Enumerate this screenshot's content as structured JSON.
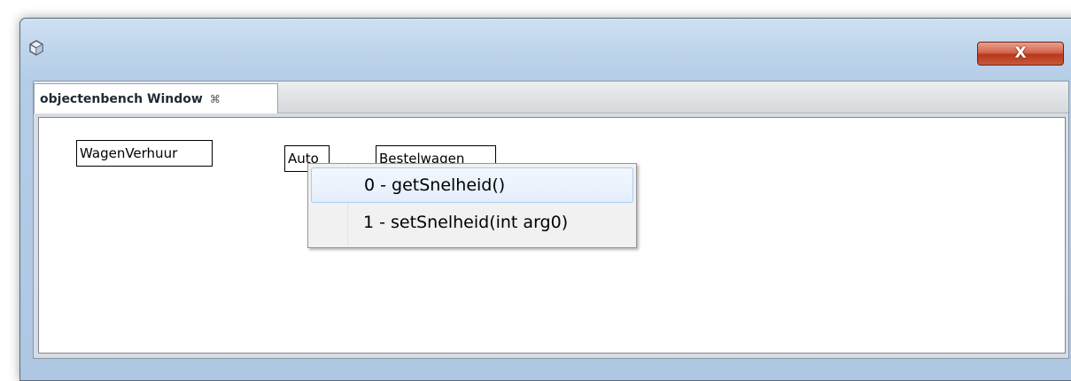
{
  "window": {
    "close_label": "X",
    "icon": "cube-icon"
  },
  "tab": {
    "title": "objectenbench Window",
    "close_icon": "tab-close-icon",
    "close_glyph": "⌘"
  },
  "bench": {
    "objects": [
      {
        "label": "WagenVerhuur"
      },
      {
        "label": "Auto"
      },
      {
        "label": "Bestelwagen"
      }
    ]
  },
  "popup_menu": {
    "items": [
      {
        "label": "0 - getSnelheid()",
        "selected": true
      },
      {
        "label": "1 - setSnelheid(int arg0)",
        "selected": false
      }
    ]
  },
  "colors": {
    "title_bar": "#bfd5ec",
    "close_button": "#c85a3c",
    "menu_highlight": "#e3eefb"
  }
}
